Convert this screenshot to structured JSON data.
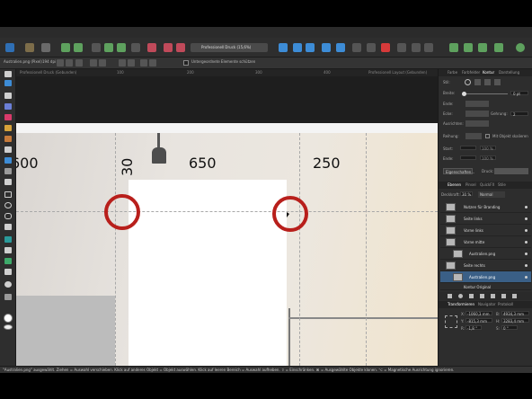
{
  "document": {
    "filename": "Australien.png (Pixel)",
    "size": "194 dpi",
    "lock_label": "Untergeordnete Elemente schützen",
    "zoom_left": "Professionell Druck (15,6%)",
    "zoom_right": "Professionell Layout (Gebunden)"
  },
  "tabs": [
    "Professionell Druck (Gebunden)",
    "100",
    "200",
    "300",
    "400",
    "Professionell Layout (Gebunden)"
  ],
  "canvas": {
    "dims": {
      "left": "600",
      "center": "650",
      "right": "250",
      "vertical": "30"
    }
  },
  "status_bar": "\"Australien.png\" ausgewählt. Ziehen = Auswahl verschieben. Klick auf anderes Objekt = Objekt auswählen. Klick auf leeren Bereich = Auswahl aufheben. ⇧ = Einschränken. ⌘ = Ausgewählte Objekte klonen. ⌥ = Magnetische Ausrichtung ignorieren.",
  "stroke_panel": {
    "tabs": [
      "Farbe",
      "Farbfelder",
      "Kontur",
      "Darstellung"
    ],
    "style_label": "Stil:",
    "width_label": "Breite:",
    "width_value": "0 pt",
    "cap_label": "Ende:",
    "join_label": "Ecke:",
    "miter_label": "Gehrung:",
    "miter_value": "2",
    "align_label": "Ausrichten:",
    "order_label": "Reihung:",
    "scale_label": "Mit Objekt skalieren",
    "start_label": "Start:",
    "start_value": "100 %",
    "end_label": "Ende:",
    "end_value": "100 %",
    "props_button": "Eigenschaften...",
    "pressure_label": "Druck:"
  },
  "layers_panel": {
    "tabs": [
      "Ebenen",
      "Pinsel",
      "QuickFX",
      "Stile"
    ],
    "opacity_label": "Deckkraft:",
    "opacity_value": "30 %",
    "blend_mode": "Normal",
    "layers": [
      "Nutzen für Branding",
      "Seite links",
      "Vorne links",
      "Vorne mitte",
      "Australien.png",
      "Seite rechts",
      "Australien.png",
      "Kontur Original"
    ],
    "selected_index": 6
  },
  "transform_panel": {
    "tabs": [
      "Transformieren",
      "Navigator",
      "Protokoll"
    ],
    "x_label": "X:",
    "x_value": "-1060,3 mm",
    "w_label": "B:",
    "w_value": "4934,3 mm",
    "y_label": "Y:",
    "y_value": "-815,3 mm",
    "h_label": "H:",
    "h_value": "3283,4 mm",
    "r_label": "R:",
    "r_value": "-1,8 °",
    "s_label": "S:",
    "s_value": "0 °"
  },
  "colors": {
    "accent": "#2f6fb4",
    "annotation_red": "#b81f1b",
    "selected_layer": "#3a5f86"
  }
}
